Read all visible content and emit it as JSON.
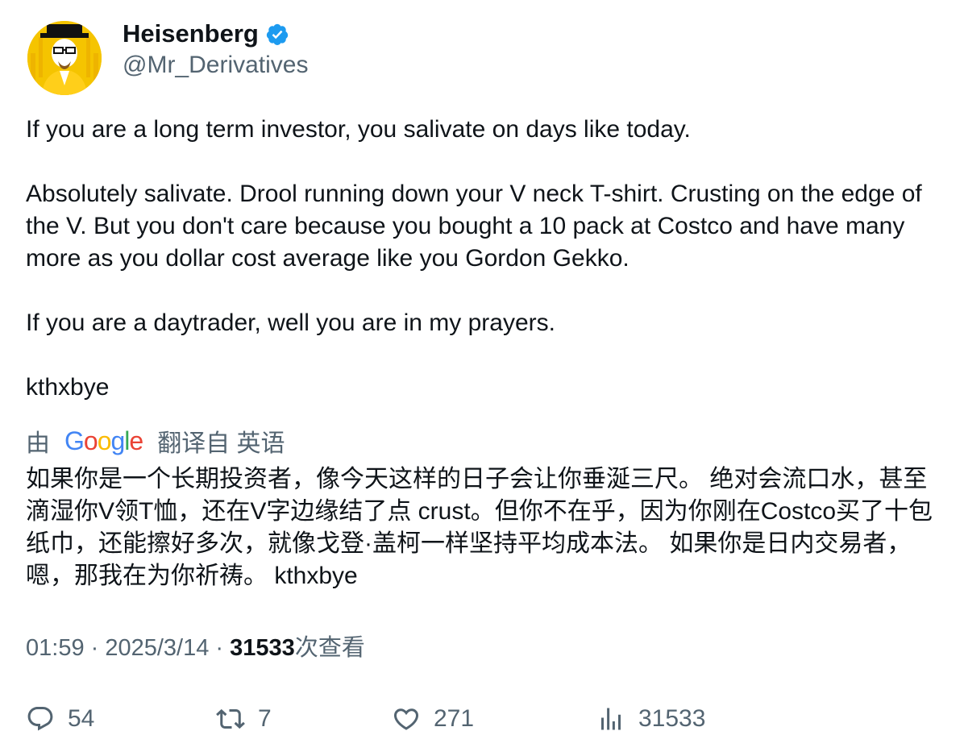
{
  "author": {
    "display_name": "Heisenberg",
    "handle": "@Mr_Derivatives",
    "verified": true,
    "avatar_icon": "heisenberg-avatar"
  },
  "tweet": {
    "paragraphs": [
      "If you are a long term investor, you salivate on days like today.",
      "Absolutely salivate. Drool running down your V neck T-shirt. Crusting on the edge of the V. But you don't care because you bought a 10 pack at Costco and have many more as you dollar cost average like you Gordon Gekko.",
      "If you are a daytrader, well you are in my prayers.",
      "kthxbye"
    ]
  },
  "translation": {
    "prefix": "由",
    "provider": "Google",
    "suffix": "翻译自 英语",
    "text": "如果你是一个长期投资者，像今天这样的日子会让你垂涎三尺。 绝对会流口水，甚至滴湿你V领T恤，还在V字边缘结了点 crust。但你不在乎，因为你刚在Costco买了十包纸巾，还能擦好多次，就像戈登·盖柯一样坚持平均成本法。 如果你是日内交易者，嗯，那我在为你祈祷。 kthxbye"
  },
  "meta": {
    "time": "01:59",
    "separator": " · ",
    "date": "2025/3/14",
    "views_count": "31533",
    "views_label": "次查看"
  },
  "actions": {
    "replies": "54",
    "retweets": "7",
    "likes": "271",
    "views": "31533"
  },
  "colors": {
    "text": "#0f1419",
    "secondary": "#536471",
    "verified_badge": "#1d9bf0",
    "avatar_bg": "#f5c400"
  }
}
